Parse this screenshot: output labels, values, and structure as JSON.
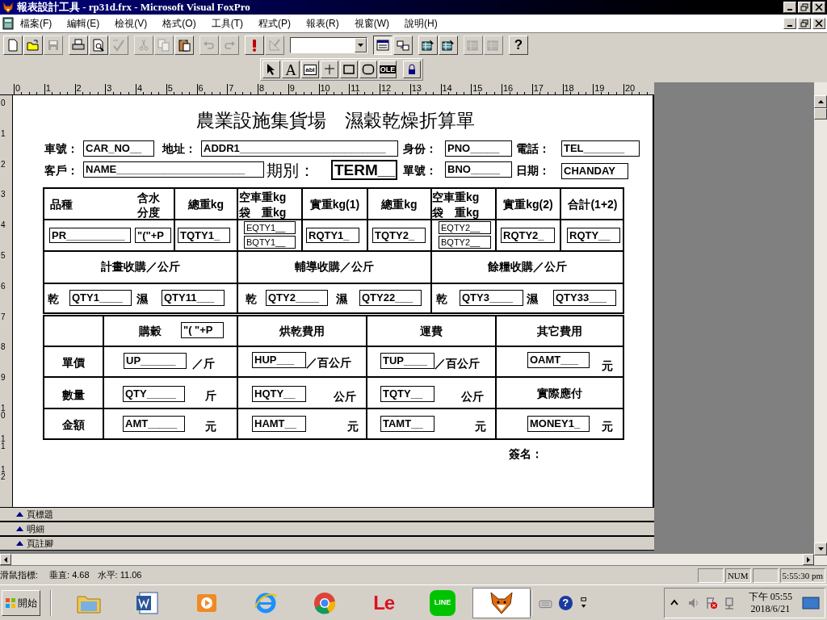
{
  "window": {
    "title": "報表設計工具 - rp31d.frx - Microsoft Visual FoxPro"
  },
  "menu": [
    "檔案(F)",
    "編輯(E)",
    "檢視(V)",
    "格式(O)",
    "工具(T)",
    "程式(P)",
    "報表(R)",
    "視窗(W)",
    "說明(H)"
  ],
  "toolbar": [
    [
      {
        "kind": "new",
        "disabled": false,
        "selected": false
      },
      {
        "kind": "open",
        "disabled": false,
        "selected": false
      },
      {
        "kind": "save",
        "disabled": true,
        "selected": false
      }
    ],
    [
      {
        "kind": "print",
        "disabled": false,
        "selected": false
      },
      {
        "kind": "preview",
        "disabled": false,
        "selected": false
      },
      {
        "kind": "spelling",
        "disabled": true,
        "selected": false
      }
    ],
    [
      {
        "kind": "cut",
        "disabled": true,
        "selected": false
      },
      {
        "kind": "copy",
        "disabled": true,
        "selected": false
      },
      {
        "kind": "paste",
        "disabled": false,
        "selected": false
      }
    ],
    [
      {
        "kind": "undo",
        "disabled": true,
        "selected": false
      },
      {
        "kind": "redo",
        "disabled": true,
        "selected": false
      }
    ],
    [
      {
        "kind": "run",
        "disabled": false,
        "selected": false
      },
      {
        "kind": "wizard",
        "disabled": true,
        "selected": false
      }
    ],
    [
      {
        "kind": "combo"
      }
    ],
    [
      {
        "kind": "layout",
        "disabled": false,
        "selected": true
      },
      {
        "kind": "data",
        "disabled": false,
        "selected": false
      }
    ],
    [
      {
        "kind": "report",
        "disabled": false,
        "selected": false
      },
      {
        "kind": "report",
        "disabled": false,
        "selected": false
      }
    ],
    [
      {
        "kind": "build",
        "disabled": true,
        "selected": false
      },
      {
        "kind": "build",
        "disabled": true,
        "selected": false
      }
    ],
    [
      {
        "kind": "help",
        "glyph": "?",
        "disabled": false,
        "selected": false
      }
    ]
  ],
  "controls_toolbar": [
    {
      "kind": "pointer"
    },
    {
      "kind": "label",
      "glyph": "A"
    },
    {
      "kind": "field",
      "glyph": "abl"
    },
    {
      "kind": "line"
    },
    {
      "kind": "rectangle"
    },
    {
      "kind": "rounded"
    },
    {
      "kind": "picture",
      "glyph": "OLE"
    },
    {
      "kind": "lock"
    }
  ],
  "top_ruler": [
    "0",
    "1",
    "2",
    "3",
    "4",
    "5",
    "6",
    "7",
    "8",
    "9",
    "10",
    "11",
    "12",
    "13",
    "14",
    "15",
    "16",
    "17",
    "18",
    "19",
    "20"
  ],
  "left_ruler": [
    "0",
    "1",
    "2",
    "3",
    "4",
    "5",
    "6",
    "7",
    "8",
    "9",
    "10",
    "11",
    "12"
  ],
  "report": {
    "items": [
      {
        "kind": "title",
        "text": "農業設施集貨場　濕穀乾燥折算單"
      },
      {
        "kind": "label",
        "text": "車號："
      },
      {
        "kind": "field",
        "text": "CAR_NO__"
      },
      {
        "kind": "label",
        "text": "地址："
      },
      {
        "kind": "field",
        "text": "ADDR1_________________________"
      },
      {
        "kind": "label",
        "text": "身份："
      },
      {
        "kind": "field",
        "text": "PNO_____"
      },
      {
        "kind": "label",
        "text": "電話："
      },
      {
        "kind": "field",
        "text": "TEL_______"
      },
      {
        "kind": "label",
        "text": "客戶："
      },
      {
        "kind": "field",
        "text": "NAME______________________"
      },
      {
        "kind": "label_large",
        "text": "期別："
      },
      {
        "kind": "field_large",
        "text": "TERM__"
      },
      {
        "kind": "label",
        "text": "單號："
      },
      {
        "kind": "field",
        "text": "BNO_____"
      },
      {
        "kind": "label",
        "text": "日期："
      },
      {
        "kind": "field",
        "text": "CHANDAY"
      },
      {
        "kind": "label",
        "text": "品種"
      },
      {
        "kind": "label",
        "text": "含水"
      },
      {
        "kind": "label",
        "text": "分度"
      },
      {
        "kind": "heading",
        "text": "總重kg"
      },
      {
        "kind": "label",
        "text": "空車重kg"
      },
      {
        "kind": "label",
        "text": "袋　重kg"
      },
      {
        "kind": "heading",
        "text": "實重kg(1)"
      },
      {
        "kind": "heading",
        "text": "總重kg"
      },
      {
        "kind": "label",
        "text": "空車重kg"
      },
      {
        "kind": "label",
        "text": "袋　重kg"
      },
      {
        "kind": "heading",
        "text": "實重kg(2)"
      },
      {
        "kind": "heading",
        "text": "合計(1+2)"
      },
      {
        "kind": "field",
        "text": "PR__________"
      },
      {
        "kind": "field",
        "text": "\"(\"+P"
      },
      {
        "kind": "field",
        "text": "TQTY1_"
      },
      {
        "kind": "field_small",
        "text": "EQTY1__"
      },
      {
        "kind": "field_small",
        "text": "BQTY1__"
      },
      {
        "kind": "field",
        "text": "RQTY1_"
      },
      {
        "kind": "field",
        "text": "TQTY2_"
      },
      {
        "kind": "field_small",
        "text": "EQTY2__"
      },
      {
        "kind": "field_small",
        "text": "BQTY2__"
      },
      {
        "kind": "field",
        "text": "RQTY2_"
      },
      {
        "kind": "field",
        "text": "RQTY__"
      },
      {
        "kind": "heading",
        "text": "計畫收購／公斤"
      },
      {
        "kind": "heading",
        "text": "輔導收購／公斤"
      },
      {
        "kind": "heading",
        "text": "餘糧收購／公斤"
      },
      {
        "kind": "label",
        "text": "乾"
      },
      {
        "kind": "field",
        "text": "QTY1____"
      },
      {
        "kind": "label",
        "text": "濕"
      },
      {
        "kind": "field",
        "text": "QTY11___"
      },
      {
        "kind": "label",
        "text": "乾"
      },
      {
        "kind": "field",
        "text": "QTY2____"
      },
      {
        "kind": "label",
        "text": "濕"
      },
      {
        "kind": "field",
        "text": "QTY22___"
      },
      {
        "kind": "label",
        "text": "乾"
      },
      {
        "kind": "field",
        "text": "QTY3____"
      },
      {
        "kind": "label",
        "text": "濕"
      },
      {
        "kind": "field",
        "text": "QTY33___"
      },
      {
        "kind": "label",
        "text": "購穀"
      },
      {
        "kind": "field",
        "text": "\"( \"+P"
      },
      {
        "kind": "heading",
        "text": "烘乾費用"
      },
      {
        "kind": "heading",
        "text": "運費"
      },
      {
        "kind": "heading",
        "text": "其它費用"
      },
      {
        "kind": "heading",
        "text": "單價"
      },
      {
        "kind": "field",
        "text": "UP______"
      },
      {
        "kind": "label",
        "text": "／斤"
      },
      {
        "kind": "field",
        "text": "HUP___"
      },
      {
        "kind": "label",
        "text": "／百公斤"
      },
      {
        "kind": "field",
        "text": "TUP____"
      },
      {
        "kind": "label",
        "text": "／百公斤"
      },
      {
        "kind": "field",
        "text": "OAMT___"
      },
      {
        "kind": "label",
        "text": "元"
      },
      {
        "kind": "heading",
        "text": "數量"
      },
      {
        "kind": "field",
        "text": "QTY_____"
      },
      {
        "kind": "label",
        "text": "斤"
      },
      {
        "kind": "field",
        "text": "HQTY__"
      },
      {
        "kind": "label",
        "text": "公斤"
      },
      {
        "kind": "field",
        "text": "TQTY__"
      },
      {
        "kind": "label",
        "text": "公斤"
      },
      {
        "kind": "heading",
        "text": "實際應付"
      },
      {
        "kind": "heading",
        "text": "金額"
      },
      {
        "kind": "field",
        "text": "AMT_____"
      },
      {
        "kind": "label",
        "text": "元"
      },
      {
        "kind": "field",
        "text": "HAMT__"
      },
      {
        "kind": "label",
        "text": "元"
      },
      {
        "kind": "field",
        "text": "TAMT__"
      },
      {
        "kind": "label",
        "text": "元"
      },
      {
        "kind": "field",
        "text": "MONEY1_"
      },
      {
        "kind": "label",
        "text": "元"
      },
      {
        "kind": "label",
        "text": "簽名："
      }
    ]
  },
  "bands": [
    "頁標題",
    "明細",
    "頁註腳"
  ],
  "status_bar": {
    "label": "滑鼠指標:",
    "vertical": "垂直: 4.68",
    "horizontal": "水平: 11.06",
    "panels": [
      {
        "text": "NUM"
      },
      {
        "text": "5:55:30 pm"
      }
    ]
  },
  "taskbar": {
    "start": "開始",
    "apps": [
      {
        "kind": "folder",
        "selected": false
      },
      {
        "kind": "document",
        "selected": false
      },
      {
        "kind": "media",
        "selected": false
      },
      {
        "kind": "browser-e",
        "selected": false
      },
      {
        "kind": "browser-ring",
        "selected": false
      },
      {
        "kind": "text-logo",
        "label": "Le",
        "selected": false
      },
      {
        "kind": "chat",
        "label": "LINE",
        "selected": false
      },
      {
        "kind": "fox",
        "selected": true
      }
    ],
    "tools": [
      {
        "kind": "keyboard"
      },
      {
        "kind": "help",
        "glyph": "?"
      },
      {
        "kind": "arrows"
      }
    ],
    "tray": [
      {
        "kind": "caret"
      },
      {
        "kind": "speaker"
      },
      {
        "kind": "flag"
      },
      {
        "kind": "network"
      }
    ],
    "time": "下午 05:55",
    "date": "2018/6/21"
  }
}
